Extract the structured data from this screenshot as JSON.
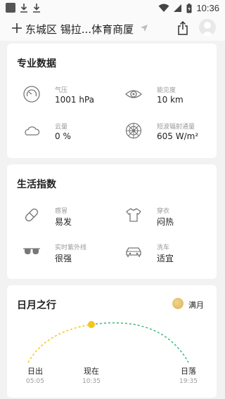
{
  "statusbar": {
    "time": "10:36"
  },
  "header": {
    "location": "东城区 锡拉...体育商厦"
  },
  "pro": {
    "title": "专业数据",
    "items": [
      {
        "label": "气压",
        "value": "1001 hPa",
        "icon": "gauge-icon"
      },
      {
        "label": "能见度",
        "value": "10 km",
        "icon": "eye-icon"
      },
      {
        "label": "云量",
        "value": "0 %",
        "icon": "cloud-icon"
      },
      {
        "label": "短波辐射通量",
        "value": "605 W/m²",
        "icon": "radiation-icon"
      }
    ]
  },
  "life": {
    "title": "生活指数",
    "items": [
      {
        "label": "感冒",
        "value": "易发",
        "icon": "pill-icon"
      },
      {
        "label": "穿衣",
        "value": "闷热",
        "icon": "shirt-icon"
      },
      {
        "label": "实时紫外线",
        "value": "很强",
        "icon": "sunglasses-icon"
      },
      {
        "label": "洗车",
        "value": "适宜",
        "icon": "car-icon"
      }
    ]
  },
  "sunmoon": {
    "title": "日月之行",
    "moon_phase": "满月",
    "sunrise_label": "日出",
    "sunrise_time": "05:05",
    "now_label": "现在",
    "now_time": "10:35",
    "sunset_label": "日落",
    "sunset_time": "19:35"
  },
  "colors": {
    "sun": "#f5c518",
    "arc_past": "#f5c518",
    "arc_future": "#3cb878"
  }
}
